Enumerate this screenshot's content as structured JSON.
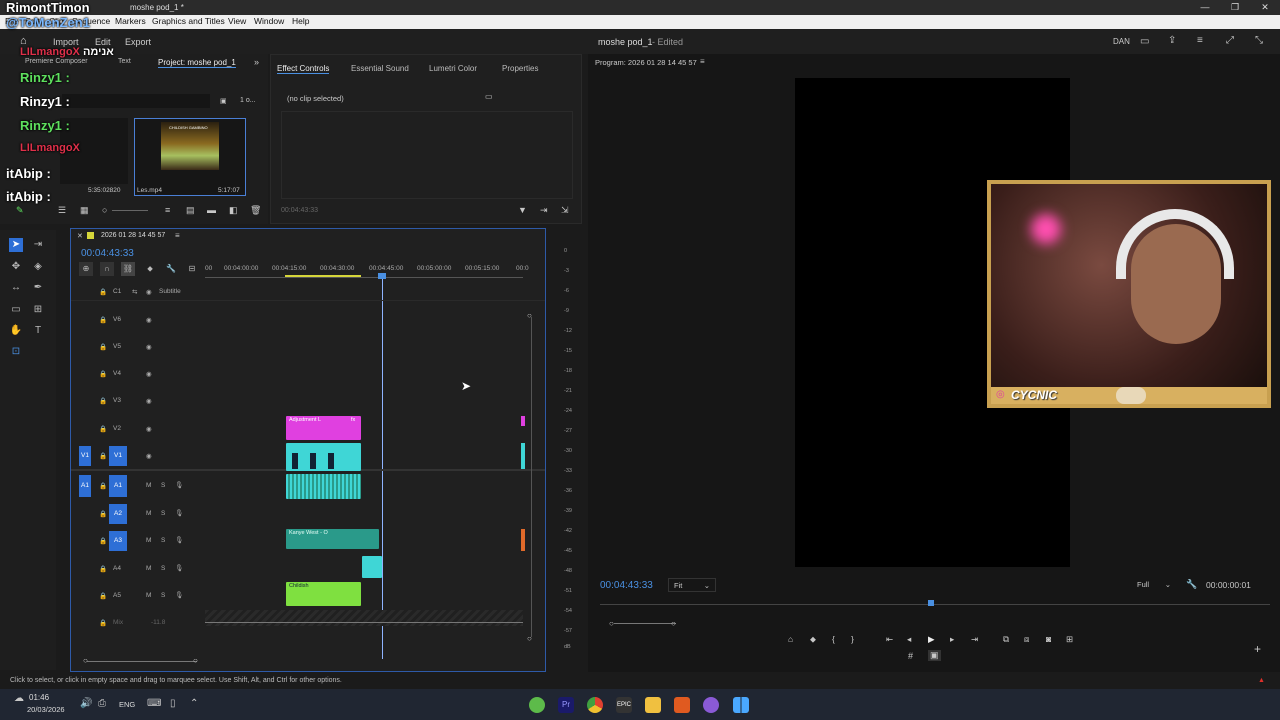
{
  "window": {
    "title": "moshe pod_1 *",
    "min": "—",
    "max": "❐",
    "close": "✕"
  },
  "menu": [
    "File",
    "Edit",
    "Clip",
    "Sequence",
    "Markers",
    "Graphics and Titles",
    "View",
    "Window",
    "Help"
  ],
  "header": {
    "import": "Import",
    "edit": "Edit",
    "export": "Export",
    "doc_title": "moshe pod_1",
    "doc_status": "- Edited",
    "lang": "DAN"
  },
  "chat_overlay": {
    "lines": [
      {
        "name": "RimontTimon",
        "msg": "@ToMenZen1",
        "color": "#ffffff"
      },
      {
        "name": "LILmangoX",
        "msg": "אנימה",
        "color": "#e0304a"
      },
      {
        "name": "Rinzy1",
        "msg": ":",
        "color": "#5ee05e"
      },
      {
        "name": "Rinzy1",
        "msg": ":",
        "color": "#ffffff"
      },
      {
        "name": "Rinzy1",
        "msg": ":",
        "color": "#5ee05e"
      },
      {
        "name": "LILmangoX",
        "msg": "",
        "color": "#e0304a"
      },
      {
        "name": "itAbip",
        "msg": ":",
        "color": "#ffffff"
      },
      {
        "name": "itAbip",
        "msg": ":",
        "color": "#ffffff"
      }
    ]
  },
  "project": {
    "tabs": [
      "Premiere Composer",
      "Text",
      "Project: moshe pod_1"
    ],
    "item1": {
      "label": "Les.mp4",
      "dur": "5:17:07",
      "thumb_title": "CHILDISH GAMBINO"
    },
    "item0": {
      "dur": "5:35:02820"
    },
    "count": "1 o..."
  },
  "effects": {
    "tabs": [
      "Effect Controls",
      "Essential Sound",
      "Lumetri Color",
      "Properties"
    ],
    "no_clip": "(no clip selected)",
    "time": "00:04:43:33"
  },
  "timeline": {
    "seq_name": "2026 01 28 14 45 57",
    "timecode": "00:04:43:33",
    "ruler": [
      "00",
      "00:04:00:00",
      "00:04:15:00",
      "00:04:30:00",
      "00:04:45:00",
      "00:05:00:00",
      "00:05:15:00",
      "00:0"
    ],
    "tracks": [
      {
        "id": "C1",
        "label": "Subtitle"
      },
      {
        "id": "V6",
        "label": ""
      },
      {
        "id": "V5",
        "label": ""
      },
      {
        "id": "V4",
        "label": ""
      },
      {
        "id": "V3",
        "label": ""
      },
      {
        "id": "V2",
        "label": ""
      },
      {
        "id": "V1",
        "label": ""
      },
      {
        "id": "A1",
        "label": ""
      },
      {
        "id": "A2",
        "label": ""
      },
      {
        "id": "A3",
        "label": ""
      },
      {
        "id": "A4",
        "label": ""
      },
      {
        "id": "A5",
        "label": ""
      }
    ],
    "mix": {
      "label": "Mix",
      "value": "-11.8"
    },
    "clips": {
      "adjustment": "Adjustment L",
      "kanye": "Kanye West - O",
      "childish": "Childish"
    },
    "colors": {
      "adjust": "#e040e0",
      "video": "#3fd6d6",
      "audio_teal": "#2a9a8a",
      "audio_green": "#7fe040"
    }
  },
  "meter": {
    "ticks": [
      "0",
      "-3",
      "-6",
      "-9",
      "-12",
      "-15",
      "-18",
      "-21",
      "-24",
      "-27",
      "-30",
      "-33",
      "-36",
      "-39",
      "-42",
      "-45",
      "-48",
      "-51",
      "-54",
      "-57",
      "dB"
    ]
  },
  "program": {
    "title": "Program: 2026 01 28 14 45 57",
    "timecode": "00:04:43:33",
    "fit": "Fit",
    "quality": "Full",
    "duration": "00:00:00:01",
    "webcam_tag": "CYCNIC"
  },
  "status": {
    "text": "Click to select, or click in empty space and drag to marquee select. Use Shift, Alt, and Ctrl for other options."
  },
  "taskbar": {
    "time": "01:46",
    "date": "20/03/2026",
    "lang": "ENG"
  }
}
